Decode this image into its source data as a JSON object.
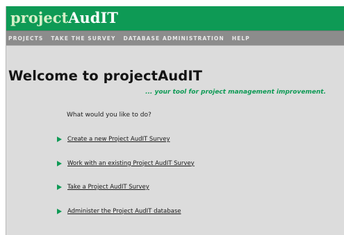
{
  "app": {
    "logo_prefix": "project",
    "logo_suffix": "AudIT"
  },
  "nav": {
    "items": [
      {
        "label": "PROJECTS"
      },
      {
        "label": "TAKE THE SURVEY"
      },
      {
        "label": "DATABASE ADMINISTRATION"
      },
      {
        "label": "HELP"
      }
    ]
  },
  "main": {
    "welcome_title": "Welcome to projectAudIT",
    "tagline": "... your tool for project management improvement.",
    "prompt": "What would you like to do?",
    "actions": [
      {
        "label": "Create a new Project AudIT Survey"
      },
      {
        "label": "Work with an existing Project AudIT Survey"
      },
      {
        "label": "Take a Project AudIT Survey"
      },
      {
        "label": "Administer the Project AudIT database"
      }
    ]
  },
  "colors": {
    "brand_green": "#0e9a55",
    "nav_gray": "#8c8c8c",
    "content_bg": "#dcdcdc"
  }
}
